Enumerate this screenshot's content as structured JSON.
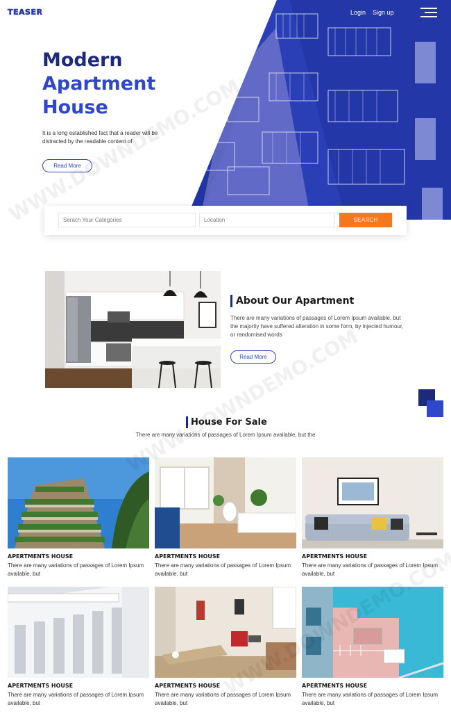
{
  "header": {
    "logo": "TEASER",
    "nav": {
      "login": "Login",
      "signup": "Sign up"
    }
  },
  "hero": {
    "title_line1": "Modern",
    "title_line2": "Apartment",
    "title_line3": "House",
    "description": "It is a long established fact that a reader will be distracted by the readable content of",
    "button": "Read More"
  },
  "search": {
    "category_placeholder": "Serach Your Categories",
    "location_placeholder": "Location",
    "button": "SEARCH"
  },
  "about": {
    "heading": "About Our Apartment",
    "description": "There are many variations of passages of Lorem Ipsum available, but the majority have suffered alteration in some form, by injected humour, or randomised words",
    "button": "Read More"
  },
  "houses": {
    "heading": "House For Sale",
    "description": "There are many variations of passages of Lorem Ipsum available, but the",
    "items": [
      {
        "title": "APERTMENTS HOUSE",
        "description": "There are many variations of passages of Lorem Ipsum available, but"
      },
      {
        "title": "APERTMENTS HOUSE",
        "description": "There are many variations of passages of Lorem Ipsum available, but"
      },
      {
        "title": "APERTMENTS HOUSE",
        "description": "There are many variations of passages of Lorem Ipsum available, but"
      },
      {
        "title": "APERTMENTS HOUSE",
        "description": "There are many variations of passages of Lorem Ipsum available, but"
      },
      {
        "title": "APERTMENTS HOUSE",
        "description": "There are many variations of passages of Lorem Ipsum available, but"
      },
      {
        "title": "APERTMENTS HOUSE",
        "description": "There are many variations of passages of Lorem Ipsum available, but"
      }
    ]
  },
  "watermark": "WWW.DOWNDEMO.COM",
  "colors": {
    "brand_dark": "#1d2a7b",
    "brand": "#2f47c8",
    "accent": "#f5781e"
  }
}
